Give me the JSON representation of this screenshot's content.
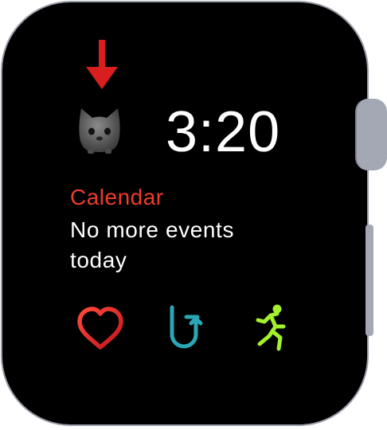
{
  "watch_face": {
    "time": "3:20",
    "calendar": {
      "title": "Calendar",
      "status": "No more events today"
    },
    "top_left_complication": {
      "icon": "cat-face-icon",
      "indicator": "red-down-arrow-icon"
    },
    "bottom_complications": [
      {
        "icon": "heart-rate-icon",
        "color": "#ee3b2e"
      },
      {
        "icon": "breathe-return-arrow-icon",
        "color": "#2aa7b6"
      },
      {
        "icon": "workout-runner-icon",
        "color": "#a3f02b"
      }
    ]
  },
  "colors": {
    "face_background": "#000000",
    "case": "#9a9ea8",
    "accent_red": "#ee3b2e"
  }
}
